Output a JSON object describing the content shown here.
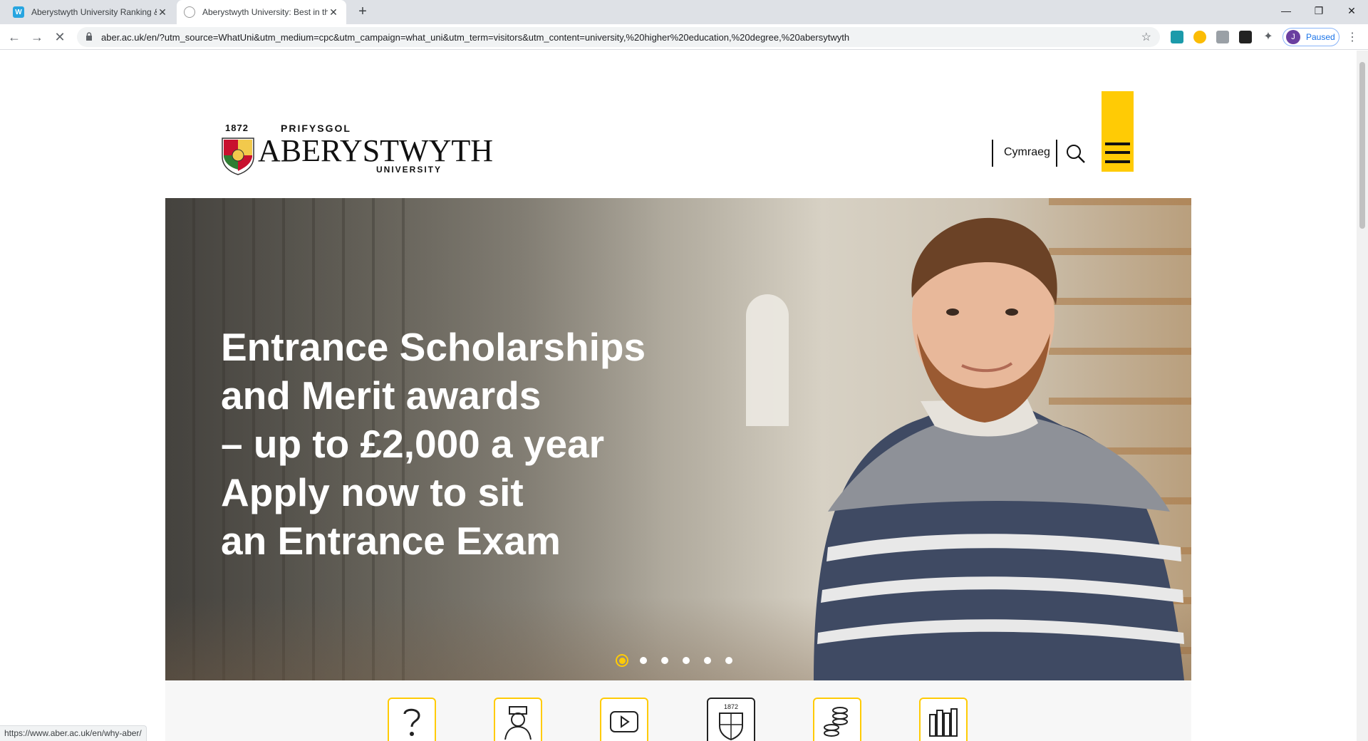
{
  "browser": {
    "tabs": [
      {
        "title": "Aberystwyth University Ranking &",
        "active": false
      },
      {
        "title": "Aberystwyth University: Best in th",
        "active": true
      }
    ],
    "new_tab": "+",
    "url": "aber.ac.uk/en/?utm_source=WhatUni&utm_medium=cpc&utm_campaign=what_uni&utm_term=visitors&utm_content=university,%20higher%20education,%20degree,%20abersytwyth",
    "profile_initial": "J",
    "profile_status": "Paused",
    "status_url": "https://www.aber.ac.uk/en/why-aber/"
  },
  "header": {
    "logo_year": "1872",
    "logo_top": "PRIFYSGOL",
    "logo_main": "ABERYSTWYTH",
    "logo_bottom": "UNIVERSITY",
    "language_link": "Cymraeg"
  },
  "hero": {
    "lines": [
      "Entrance Scholarships",
      "and Merit awards",
      "– up to £2,000 a year",
      "Apply now to sit",
      "an Entrance Exam"
    ],
    "slide_count": 6,
    "active_slide": 1
  },
  "quicklinks": [
    {
      "icon": "question-icon"
    },
    {
      "icon": "graduate-icon"
    },
    {
      "icon": "video-play-icon"
    },
    {
      "icon": "university-crest-icon"
    },
    {
      "icon": "coins-icon"
    },
    {
      "icon": "books-icon"
    }
  ],
  "colors": {
    "brand_yellow": "#ffcb05",
    "text_dark": "#111111"
  }
}
